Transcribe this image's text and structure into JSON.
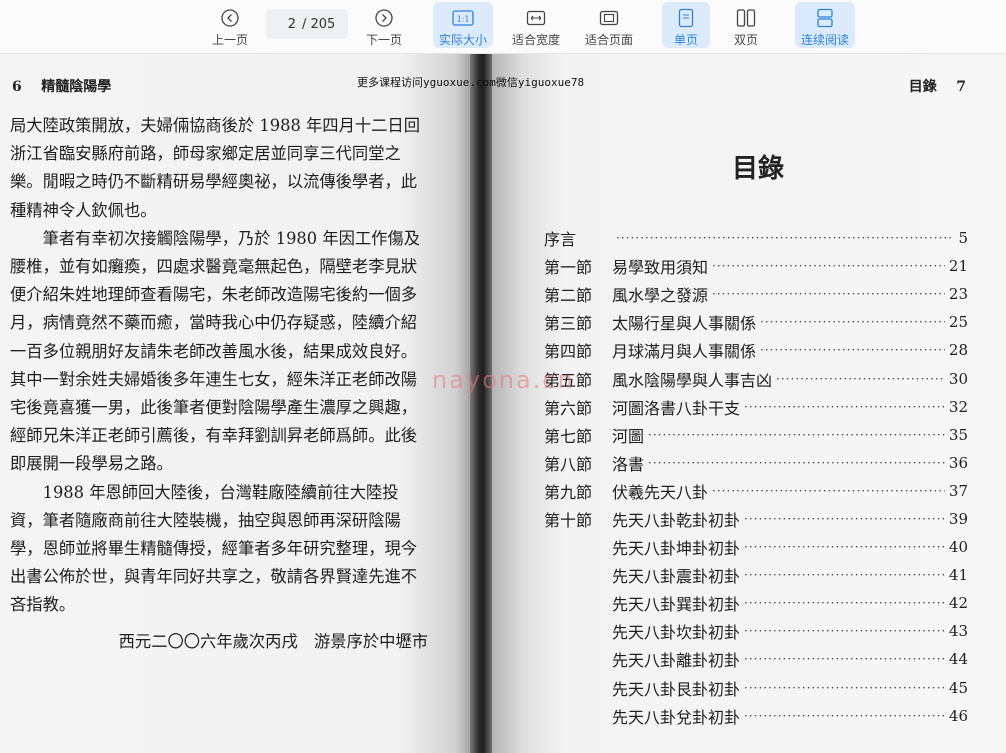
{
  "toolbar": {
    "prev_label": "上一页",
    "next_label": "下一页",
    "current_page": "2",
    "total_pages": "/ 205",
    "actual_size_label": "实际大小",
    "fit_width_label": "适合宽度",
    "fit_page_label": "适合页面",
    "single_page_label": "单页",
    "double_page_label": "双页",
    "continuous_label": "连续阅读",
    "accent_color": "#2f80d8"
  },
  "watermark_top": "更多课程访问yguoxue.com微信yiguoxue78",
  "watermark_center": "nayona.cn",
  "left_page": {
    "page_number": "6",
    "running_title": "精髓陰陽學",
    "paragraphs": [
      "局大陸政策開放，夫婦倆協商後於 1988 年四月十二日回浙江省臨安縣府前路，師母家鄉定居並同享三代同堂之樂。閒暇之時仍不斷精研易學經奧祕，以流傳後學者，此種精神令人欽佩也。",
      "筆者有幸初次接觸陰陽學，乃於 1980 年因工作傷及腰椎，並有如癱瘓，四處求醫竟毫無起色，隔壁老李見狀便介紹朱姓地理師查看陽宅，朱老師改造陽宅後約一個多月，病情竟然不藥而癒，當時我心中仍存疑惑，陸續介紹一百多位親朋好友請朱老師改善風水後，結果成效良好。其中一對余姓夫婦婚後多年連生七女，經朱洋正老師改陽宅後竟喜獲一男，此後筆者便對陰陽學產生濃厚之興趣，經師兄朱洋正老師引薦後，有幸拜劉訓昇老師爲師。此後即展開一段學易之路。",
      "1988 年恩師回大陸後，台灣鞋廠陸續前往大陸投資，筆者隨廠商前往大陸裝機，抽空與恩師再深研陰陽學，恩師並將畢生精髓傳授，經筆者多年研究整理，現今出書公佈於世，與青年同好共享之，敬請各界賢達先進不吝指教。"
    ],
    "signature": "西元二〇〇六年歲次丙戌　游景序於中壢市"
  },
  "right_page": {
    "running_title": "目錄",
    "page_number": "7",
    "toc_title": "目錄",
    "toc": [
      {
        "section": "序言",
        "title": "",
        "page": "5"
      },
      {
        "section": "第一節",
        "title": "易學致用須知",
        "page": "21"
      },
      {
        "section": "第二節",
        "title": "風水學之發源",
        "page": "23"
      },
      {
        "section": "第三節",
        "title": "太陽行星與人事關係",
        "page": "25"
      },
      {
        "section": "第四節",
        "title": "月球滿月與人事關係",
        "page": "28"
      },
      {
        "section": "第五節",
        "title": "風水陰陽學與人事吉凶",
        "page": "30"
      },
      {
        "section": "第六節",
        "title": "河圖洛書八卦干支",
        "page": "32"
      },
      {
        "section": "第七節",
        "title": "河圖",
        "page": "35"
      },
      {
        "section": "第八節",
        "title": "洛書",
        "page": "36"
      },
      {
        "section": "第九節",
        "title": "伏羲先天八卦",
        "page": "37"
      },
      {
        "section": "第十節",
        "title": "先天八卦乾卦初卦",
        "page": "39"
      },
      {
        "section": "",
        "title": "先天八卦坤卦初卦",
        "page": "40"
      },
      {
        "section": "",
        "title": "先天八卦震卦初卦",
        "page": "41"
      },
      {
        "section": "",
        "title": "先天八卦巽卦初卦",
        "page": "42"
      },
      {
        "section": "",
        "title": "先天八卦坎卦初卦",
        "page": "43"
      },
      {
        "section": "",
        "title": "先天八卦離卦初卦",
        "page": "44"
      },
      {
        "section": "",
        "title": "先天八卦艮卦初卦",
        "page": "45"
      },
      {
        "section": "",
        "title": "先天八卦兌卦初卦",
        "page": "46"
      }
    ]
  }
}
